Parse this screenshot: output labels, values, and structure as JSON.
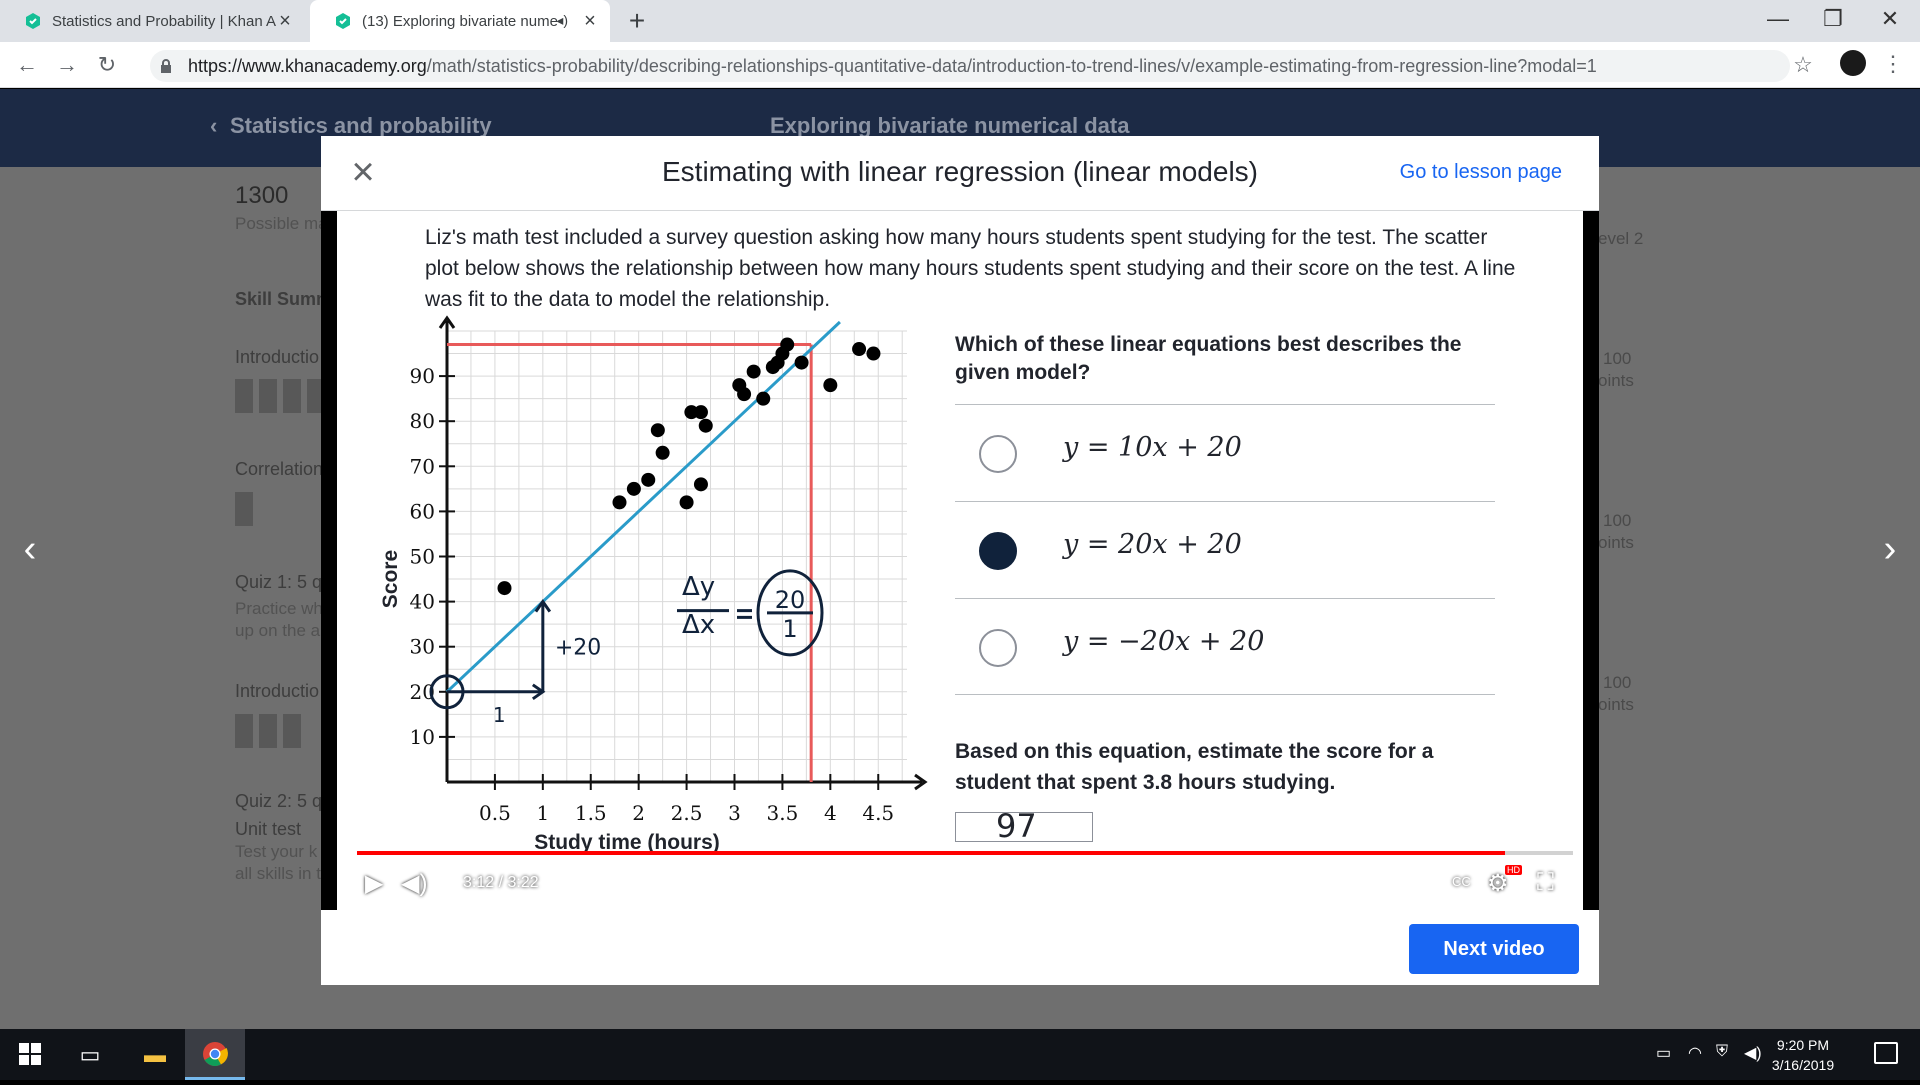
{
  "browser": {
    "tabs": [
      {
        "title": "Statistics and Probability | Khan A",
        "active": false
      },
      {
        "title": "(13) Exploring bivariate nume",
        "active": true
      }
    ],
    "new_tab_icon": "plus-icon",
    "window_controls": {
      "minimize": "—",
      "maximize": "❐",
      "close": "✕"
    },
    "nav": {
      "back": "←",
      "forward": "→",
      "reload": "↻"
    },
    "url_host": "https://www.khanacademy.org",
    "url_path": "/math/statistics-probability/describing-relationships-quantitative-data/introduction-to-trend-lines/v/example-estimating-from-regression-line?modal=1",
    "star": "☆"
  },
  "page": {
    "breadcrumb_left": "Statistics and probability",
    "breadcrumb_center": "Exploring bivariate numerical data",
    "points": "1300",
    "points_label": "Possible ma",
    "skill_summary": "Skill Summ",
    "level": "evel 2",
    "sections": [
      {
        "title": "Introductio",
        "score": "100",
        "score_label": "oints"
      },
      {
        "title": "Correlation",
        "score": "100",
        "score_label": "oints"
      },
      {
        "title": "Quiz 1: 5 q",
        "sub1": "Practice wh",
        "sub2": "up on the a"
      },
      {
        "title": "Introductio",
        "score": "100",
        "score_label": "oints"
      },
      {
        "title": "Quiz 2: 5 q"
      },
      {
        "title": "Unit test",
        "sub1": "Test your k",
        "sub2": "all skills in t"
      }
    ],
    "prev_arrow": "‹",
    "next_arrow": "›"
  },
  "modal": {
    "title": "Estimating with linear regression (linear models)",
    "lesson_link": "Go to lesson page",
    "close_icon": "×",
    "next_button": "Next video"
  },
  "video": {
    "problem_text": "Liz's math test included a survey question asking how many hours students spent studying for the test. The scatter plot below shows the relationship between how many hours students spent studying and their score on the test. A line was fit to the data to model the relationship.",
    "question": "Which of these linear equations best describes the given model?",
    "choices": [
      {
        "equation": "y = 10x + 20",
        "selected": false
      },
      {
        "equation": "y = 20x + 20",
        "selected": true
      },
      {
        "equation": "y = −20x + 20",
        "selected": false
      }
    ],
    "estimate_prompt": "Based on this equation, estimate the score for a student that spent 3.8 hours studying.",
    "answer": "97",
    "annotations": {
      "rise": "+20",
      "run": "1",
      "slope_num": "Δy",
      "slope_den": "Δx",
      "slope_val_num": "20",
      "slope_val_den": "1"
    },
    "player": {
      "time": "3:12 / 3:22",
      "progress": 0.944,
      "cc": "CC",
      "hd": "HD"
    },
    "colors": {
      "line": "#2a9bc9",
      "guide": "#e85a5a",
      "progress": "#ff0000"
    }
  },
  "chart_data": {
    "type": "scatter",
    "xlabel": "Study time (hours)",
    "ylabel": "Score",
    "xlim": [
      0,
      4.8
    ],
    "ylim": [
      0,
      100
    ],
    "xticks": [
      "0.5",
      "1",
      "1.5",
      "2",
      "2.5",
      "3",
      "3.5",
      "4",
      "4.5"
    ],
    "yticks": [
      "10",
      "20",
      "30",
      "40",
      "50",
      "60",
      "70",
      "80",
      "90"
    ],
    "points": [
      [
        0.6,
        43
      ],
      [
        1.8,
        62
      ],
      [
        1.95,
        65
      ],
      [
        2.1,
        67
      ],
      [
        2.25,
        73
      ],
      [
        2.2,
        78
      ],
      [
        2.5,
        62
      ],
      [
        2.55,
        82
      ],
      [
        2.65,
        82
      ],
      [
        2.7,
        79
      ],
      [
        2.65,
        66
      ],
      [
        3.05,
        88
      ],
      [
        3.1,
        86
      ],
      [
        3.3,
        85
      ],
      [
        3.2,
        91
      ],
      [
        3.4,
        92
      ],
      [
        3.45,
        93
      ],
      [
        3.5,
        95
      ],
      [
        3.55,
        97
      ],
      [
        3.7,
        93
      ],
      [
        4.0,
        88
      ],
      [
        4.3,
        96
      ],
      [
        4.45,
        95
      ]
    ],
    "trend_line": {
      "slope": 20,
      "intercept": 20
    },
    "guide_x": 3.8,
    "guide_y": 97,
    "grid": true
  },
  "taskbar": {
    "clock_time": "9:20 PM",
    "clock_date": "3/16/2019"
  }
}
